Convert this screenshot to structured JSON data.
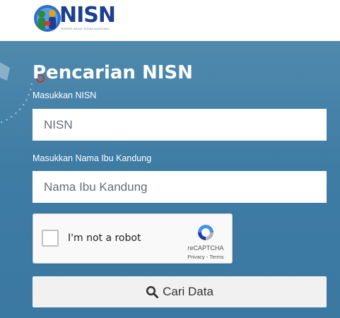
{
  "header": {
    "logo_text": "NISN",
    "logo_subtitle": "NOMOR INDUK SISWA NASIONAL"
  },
  "form": {
    "title": "Pencarian NISN",
    "nisn_label": "Masukkan NISN",
    "nisn_placeholder": "NISN",
    "nisn_value": "",
    "mother_label": "Masukkan Nama Ibu Kandung",
    "mother_placeholder": "Nama Ibu Kandung",
    "mother_value": "",
    "search_button_label": "Cari Data",
    "search_icon": "search-icon"
  },
  "captcha": {
    "label": "I'm not a robot",
    "brand": "reCAPTCHA",
    "privacy": "Privacy",
    "separator": " - ",
    "terms": "Terms",
    "checked": false
  },
  "colors": {
    "hero_background": "#3f7ca4",
    "logo_blue": "#1d3f8f",
    "button_background": "#f1f1f1",
    "captcha_background": "#f9f9f9"
  }
}
